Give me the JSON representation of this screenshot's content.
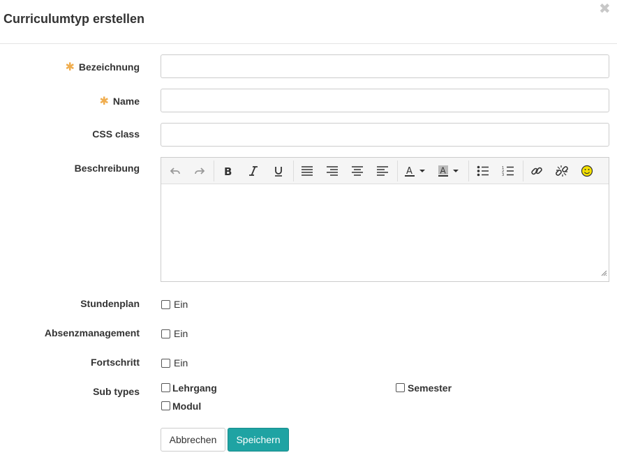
{
  "dialog": {
    "title": "Curriculumtyp erstellen",
    "close_symbol": "✖"
  },
  "form": {
    "required_marker": "✱",
    "bezeichnung": {
      "label": "Bezeichnung",
      "value": ""
    },
    "name": {
      "label": "Name",
      "value": ""
    },
    "css_class": {
      "label": "CSS class",
      "value": ""
    },
    "beschreibung": {
      "label": "Beschreibung",
      "toolbar": [
        "undo-icon",
        "redo-icon",
        "bold-icon",
        "italic-icon",
        "underline-icon",
        "align-justify-icon",
        "align-right-icon",
        "align-center-icon",
        "align-left-icon",
        "text-color-icon",
        "background-color-icon",
        "bullet-list-icon",
        "numbered-list-icon",
        "link-icon",
        "unlink-icon",
        "emoticon-icon"
      ]
    },
    "stundenplan": {
      "label": "Stundenplan",
      "option": "Ein"
    },
    "absenzmanagement": {
      "label": "Absenzmanagement",
      "option": "Ein"
    },
    "fortschritt": {
      "label": "Fortschritt",
      "option": "Ein"
    },
    "sub_types": {
      "label": "Sub types",
      "options": [
        "Lehrgang",
        "Semester",
        "Modul"
      ]
    }
  },
  "buttons": {
    "cancel": "Abbrechen",
    "save": "Speichern"
  },
  "colors": {
    "primary": "#1fa3a3",
    "required": "#f0ad4e",
    "text_color_underline": "#333333",
    "emoticon": "#f5e100"
  }
}
